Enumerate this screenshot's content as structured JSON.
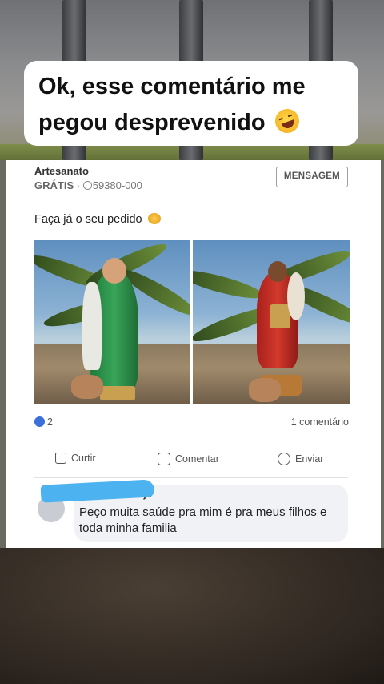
{
  "caption": {
    "line1": "Ok, esse comentário me",
    "line2": "pegou desprevenido",
    "emoji": "rolling-on-floor-laughing-emoji"
  },
  "listing": {
    "title": "Artesanato",
    "price": "GRÁTIS",
    "separator": "·",
    "zip": "59380-000",
    "message_button": "MENSAGEM",
    "post_text": "Faça já o seu pedido",
    "post_emoji": "smiling-face-with-hearts-emoji"
  },
  "stats": {
    "reactions_count": "2",
    "comments": "1 comentário"
  },
  "actions": {
    "like": "Curtir",
    "comment": "Comentar",
    "share": "Enviar"
  },
  "comment": {
    "author_partial": "Araujo",
    "text": "Peço  muita saúde  pra mim é pra meus filhos e toda minha familia"
  },
  "colors": {
    "reaction_blue": "#3b6fd9",
    "scribble_blue": "#4db3f0",
    "comment_bg": "#f0f2f5"
  }
}
